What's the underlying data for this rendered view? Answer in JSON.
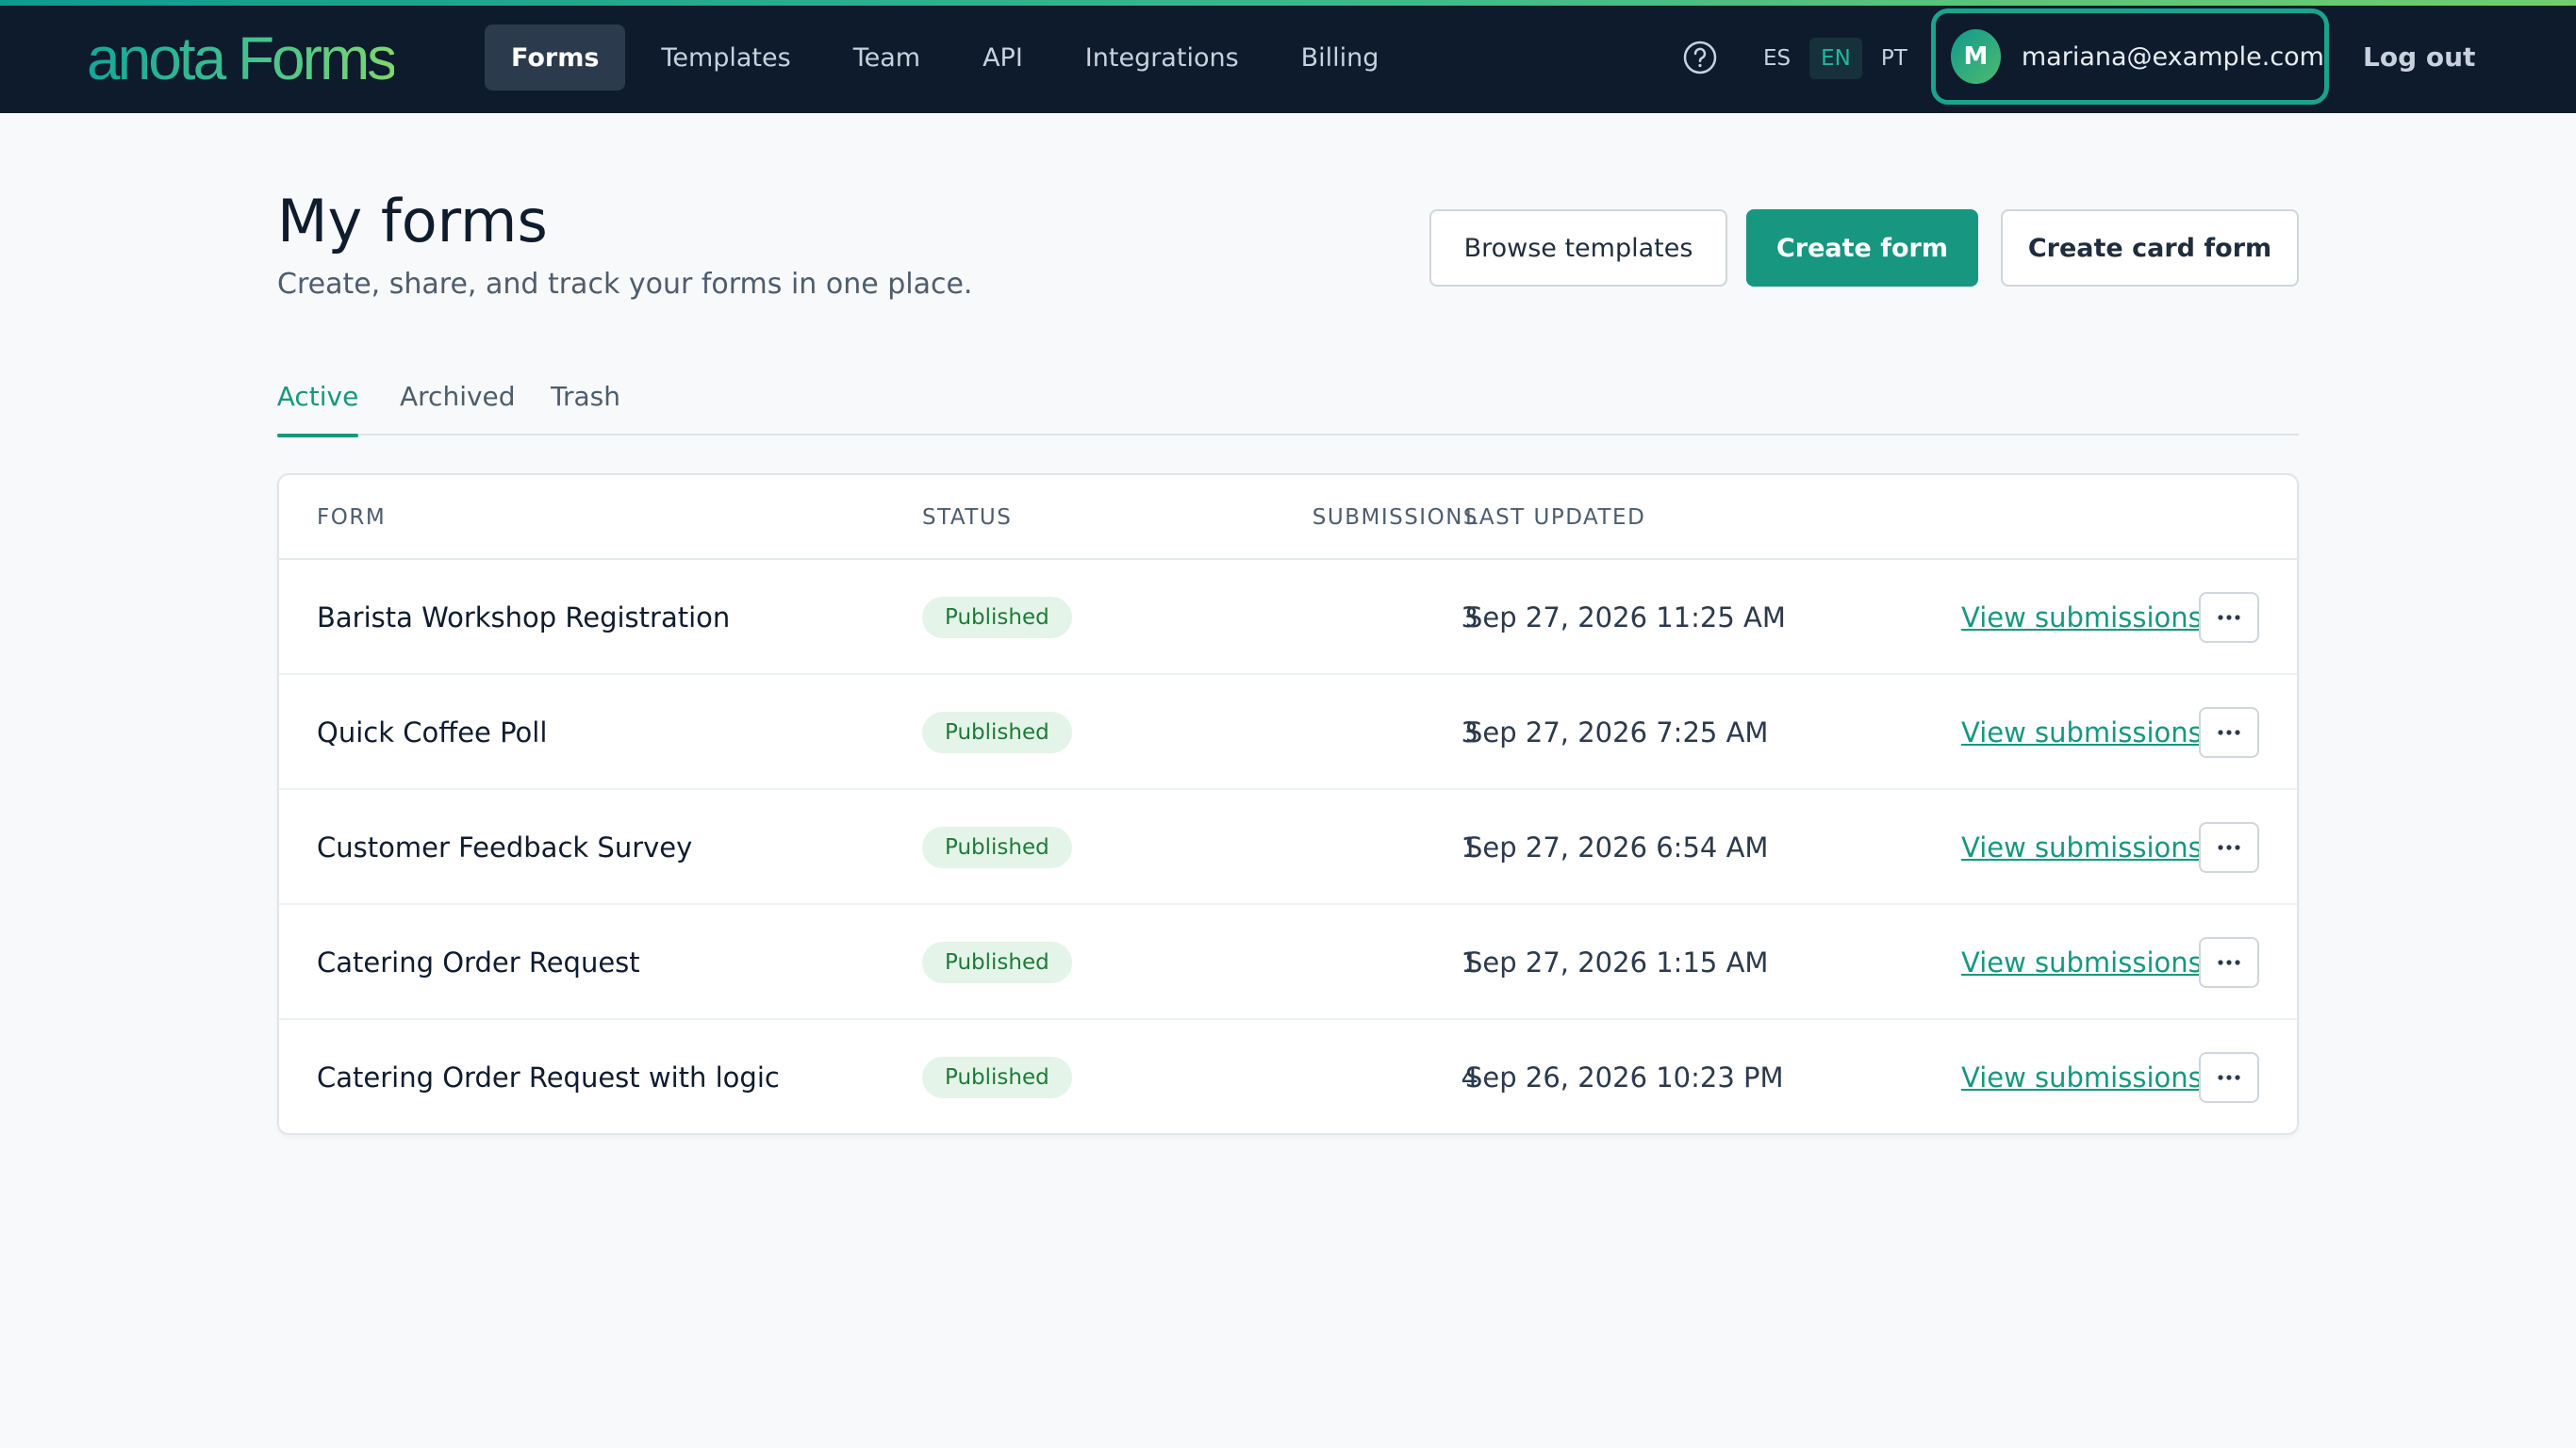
{
  "brand": {
    "logo_text": "anota Forms"
  },
  "nav": {
    "items": [
      {
        "label": "Forms",
        "active": true
      },
      {
        "label": "Templates",
        "active": false
      },
      {
        "label": "Team",
        "active": false
      },
      {
        "label": "API",
        "active": false
      },
      {
        "label": "Integrations",
        "active": false
      },
      {
        "label": "Billing",
        "active": false
      }
    ]
  },
  "header_actions": {
    "help_icon": "help-circle-icon",
    "languages": [
      {
        "code": "ES",
        "active": false
      },
      {
        "code": "EN",
        "active": true
      },
      {
        "code": "PT",
        "active": false
      }
    ],
    "user": {
      "initial": "M",
      "email": "mariana@example.com"
    },
    "logout_label": "Log out"
  },
  "page": {
    "title": "My forms",
    "subtitle": "Create, share, and track your forms in one place.",
    "buttons": {
      "browse_templates": "Browse templates",
      "create_form": "Create form",
      "create_card_form": "Create card form"
    }
  },
  "tabs": [
    {
      "label": "Active",
      "active": true
    },
    {
      "label": "Archived",
      "active": false
    },
    {
      "label": "Trash",
      "active": false
    }
  ],
  "table": {
    "columns": {
      "form": "FORM",
      "status": "STATUS",
      "submissions": "SUBMISSIONS",
      "last_updated": "LAST UPDATED"
    },
    "rows": [
      {
        "name": "Barista Workshop Registration",
        "status": "Published",
        "submissions": "3",
        "last_updated": "Sep 27, 2026 11:25 AM",
        "view_label": "View submissions"
      },
      {
        "name": "Quick Coffee Poll",
        "status": "Published",
        "submissions": "3",
        "last_updated": "Sep 27, 2026 7:25 AM",
        "view_label": "View submissions"
      },
      {
        "name": "Customer Feedback Survey",
        "status": "Published",
        "submissions": "1",
        "last_updated": "Sep 27, 2026 6:54 AM",
        "view_label": "View submissions"
      },
      {
        "name": "Catering Order Request",
        "status": "Published",
        "submissions": "1",
        "last_updated": "Sep 27, 2026 1:15 AM",
        "view_label": "View submissions"
      },
      {
        "name": "Catering Order Request with logic",
        "status": "Published",
        "submissions": "4",
        "last_updated": "Sep 26, 2026 10:23 PM",
        "view_label": "View submissions"
      }
    ],
    "row_action_icon": "more-horizontal-icon"
  },
  "colors": {
    "topbar_bg": "#0e1b2c",
    "accent": "#17977f",
    "badge_bg": "#e4f4e8",
    "badge_text": "#1f7a3a"
  }
}
